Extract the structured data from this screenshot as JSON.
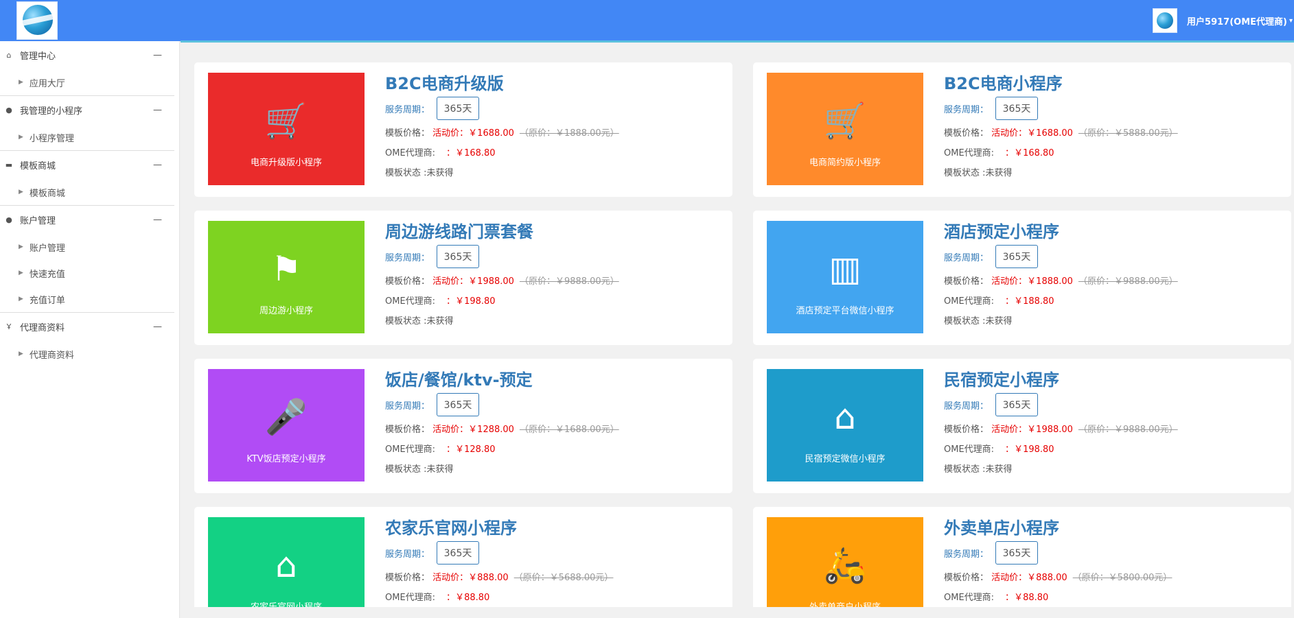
{
  "header": {
    "user_name": "用户5917(OME代理商)"
  },
  "sidebar": {
    "groups": [
      {
        "label": "管理中心",
        "icon": "home-icon",
        "items": [
          "应用大厅"
        ]
      },
      {
        "label": "我管理的小程序",
        "icon": "wechat-icon",
        "items": [
          "小程序管理"
        ]
      },
      {
        "label": "模板商城",
        "icon": "cart-icon",
        "items": [
          "模板商城"
        ]
      },
      {
        "label": "账户管理",
        "icon": "user-icon",
        "items": [
          "账户管理",
          "快速充值",
          "充值订单"
        ]
      },
      {
        "label": "代理商资料",
        "icon": "agent-icon",
        "items": [
          "代理商资料"
        ]
      }
    ]
  },
  "labels": {
    "period": "服务周期：",
    "price": "模板价格：",
    "activity": "活动价：",
    "agent": "OME代理商:",
    "agent_colon": "：",
    "status": "模板状态 :"
  },
  "products": [
    {
      "title": "B2C电商升级版",
      "thumb_label": "电商升级版小程序",
      "period": "365天",
      "activity_price": "￥1688.00",
      "original_price": "（原价：￥1888.00元）",
      "agent_price": "￥168.80",
      "status": "未获得",
      "color": "#ea2b2b",
      "icon": "shopping-cart-icon",
      "glyph": "🛒"
    },
    {
      "title": "B2C电商小程序",
      "thumb_label": "电商简约版小程序",
      "period": "365天",
      "activity_price": "￥1688.00",
      "original_price": "（原价：￥5888.00元）",
      "agent_price": "￥168.80",
      "status": "未获得",
      "color": "#ff8a2b",
      "icon": "shopping-cart-icon",
      "glyph": "🛒"
    },
    {
      "title": "周边游线路门票套餐",
      "thumb_label": "周边游小程序",
      "period": "365天",
      "activity_price": "￥1988.00",
      "original_price": "（原价：￥9888.00元）",
      "agent_price": "￥198.80",
      "status": "未获得",
      "color": "#7ed321",
      "icon": "signpost-icon",
      "glyph": "⚑"
    },
    {
      "title": "酒店预定小程序",
      "thumb_label": "酒店预定平台微信小程序",
      "period": "365天",
      "activity_price": "￥1888.00",
      "original_price": "（原价：￥9888.00元）",
      "agent_price": "￥188.80",
      "status": "未获得",
      "color": "#42a5f0",
      "icon": "building-icon",
      "glyph": "▥"
    },
    {
      "title": "饭店/餐馆/ktv-预定",
      "thumb_label": "KTV饭店预定小程序",
      "period": "365天",
      "activity_price": "￥1288.00",
      "original_price": "（原价：￥1688.00元）",
      "agent_price": "￥128.80",
      "status": "未获得",
      "color": "#b14cf5",
      "icon": "microphone-icon",
      "glyph": "🎤"
    },
    {
      "title": "民宿预定小程序",
      "thumb_label": "民宿预定微信小程序",
      "period": "365天",
      "activity_price": "￥1988.00",
      "original_price": "（原价：￥9888.00元）",
      "agent_price": "￥198.80",
      "status": "未获得",
      "color": "#1e9ccb",
      "icon": "guesthouse-icon",
      "glyph": "⌂"
    },
    {
      "title": "农家乐官网小程序",
      "thumb_label": "农家乐官网小程序",
      "period": "365天",
      "activity_price": "￥888.00",
      "original_price": "（原价：￥5688.00元）",
      "agent_price": "￥88.80",
      "status": "",
      "color": "#13d184",
      "icon": "farmhouse-icon",
      "glyph": "⌂"
    },
    {
      "title": "外卖单店小程序",
      "thumb_label": "外卖单商户小程序",
      "period": "365天",
      "activity_price": "￥888.00",
      "original_price": "（原价：￥5800.00元）",
      "agent_price": "￥88.80",
      "status": "",
      "color": "#ff9f0a",
      "icon": "delivery-scooter-icon",
      "glyph": "🛵"
    }
  ]
}
